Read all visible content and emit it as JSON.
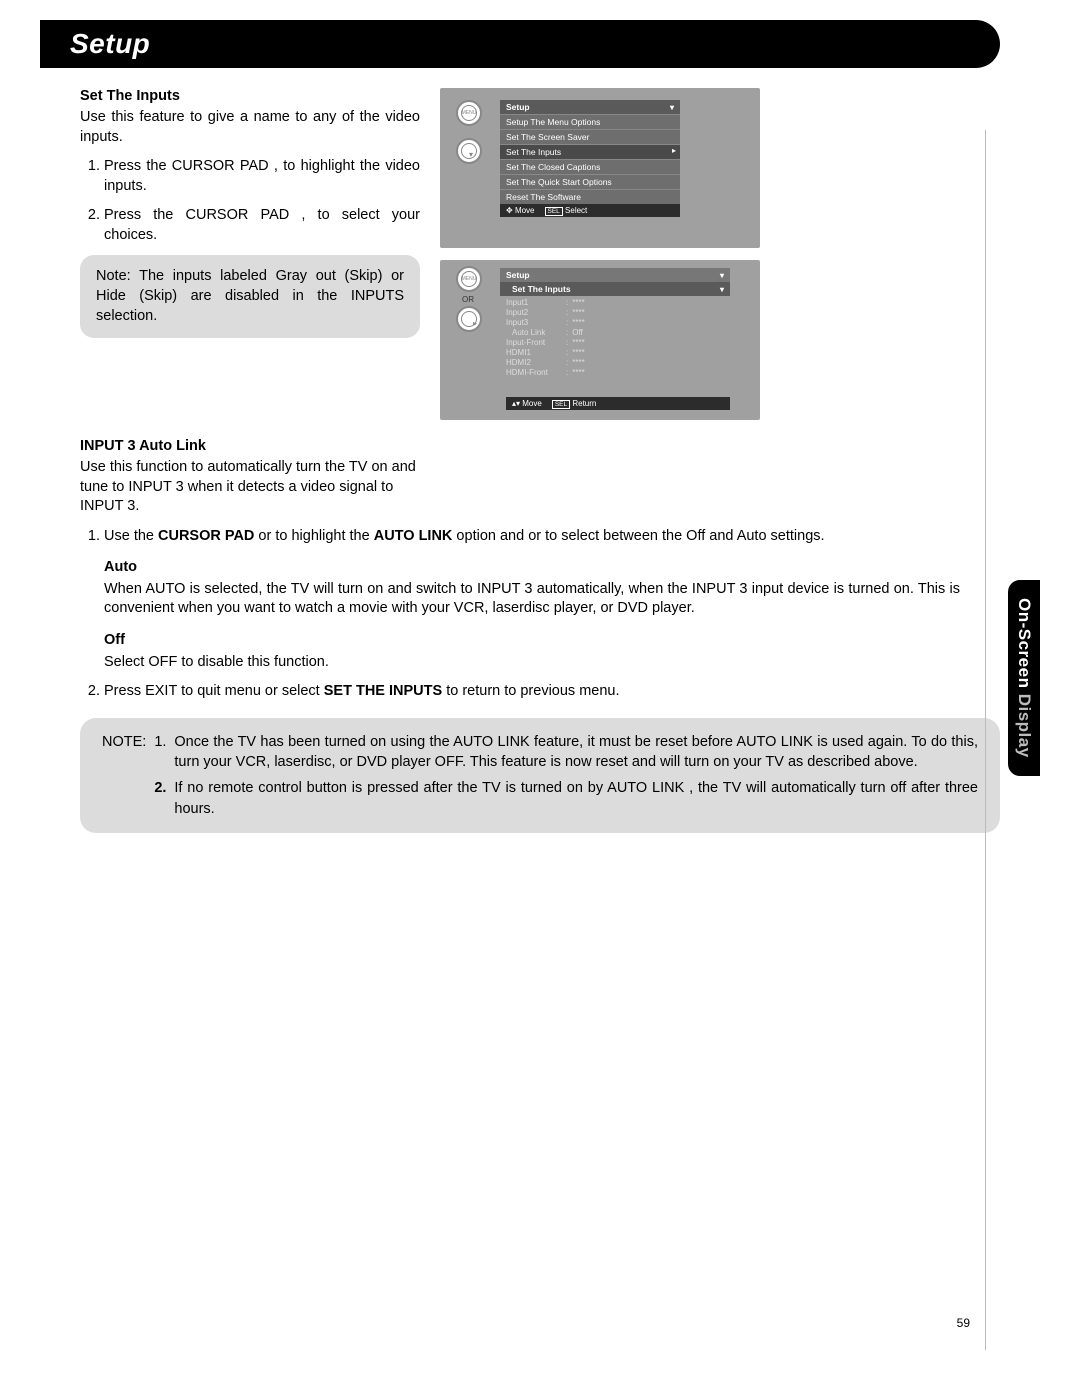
{
  "header": {
    "title": "Setup"
  },
  "sideTab": {
    "title1": "On-Screen",
    "title2": " Display"
  },
  "pageNumber": "59",
  "section1": {
    "title": "Set The Inputs",
    "intro": "Use this feature to give a name to any of the video inputs.",
    "step1": "Press the CURSOR PAD     ,      to highlight the video inputs.",
    "step2": "Press the CURSOR PAD   ,    to select your choices.",
    "note": "Note:  The inputs labeled Gray out (Skip) or Hide (Skip) are disabled in the  INPUTS selection."
  },
  "osd1": {
    "title": "Setup",
    "items": [
      "Setup The Menu Options",
      "Set The Screen Saver",
      "Set The Inputs",
      "Set The Closed Captions",
      "Set The Quick Start Options",
      "Reset The Software"
    ],
    "footerMove": "Move",
    "footerSel": "SEL",
    "footerSelect": "Select"
  },
  "osd2": {
    "title": "Setup",
    "sub": "Set The Inputs",
    "rows": [
      {
        "k": "Input1",
        "v": "****"
      },
      {
        "k": "Input2",
        "v": "****"
      },
      {
        "k": "Input3",
        "v": "****"
      },
      {
        "k": "Auto Link",
        "v": "Off"
      },
      {
        "k": "Input-Front",
        "v": "****"
      },
      {
        "k": "HDMI1",
        "v": "****"
      },
      {
        "k": "HDMI2",
        "v": "****"
      },
      {
        "k": "HDMI-Front",
        "v": "****"
      }
    ],
    "footerMove": "Move",
    "footerSel": "SEL",
    "footerReturn": "Return",
    "or": "OR"
  },
  "section2": {
    "title": "INPUT 3 Auto Link",
    "intro": "Use this function to automatically turn the TV on and tune to INPUT 3 when it detects a video signal to INPUT 3.",
    "step1a": "Use the ",
    "step1b": "CURSOR PAD",
    "step1c": "     or      to highlight the ",
    "step1d": "AUTO LINK",
    "step1e": " option and     or     to select between the Off and Auto settings.",
    "autoHead": "Auto",
    "autoText": "When AUTO is selected, the TV will turn on and switch to INPUT 3 automatically, when the INPUT 3 input device is turned on. This is convenient when you want to watch a movie with your VCR, laserdisc player, or DVD player.",
    "offHead": "Off",
    "offText": "Select OFF to disable this function.",
    "step2a": "Press EXIT to quit menu or select ",
    "step2b": "SET THE INPUTS",
    "step2c": " to return to previous menu."
  },
  "noteWide": {
    "label": "NOTE:",
    "n1": "1.",
    "t1": "Once the TV has been turned on using the   AUTO LINK  feature, it must be reset before   AUTO LINK is used again. To do this, turn your VCR, laserdisc, or DVD player OFF. This feature is now reset and will turn on your TV as described above.",
    "n2": "2.",
    "t2": "If no remote control button is pressed after the TV is turned on by    AUTO LINK , the TV will automatically turn off after three hours."
  }
}
